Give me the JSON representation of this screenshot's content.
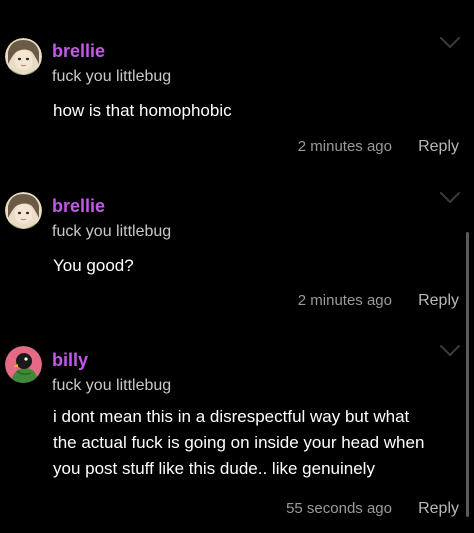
{
  "colors": {
    "background": "#000000",
    "username": "#c259e8",
    "body_text": "#ffffff",
    "secondary_text": "#c9c9c9",
    "meta_text": "#9a9a9a"
  },
  "comments": [
    {
      "username": "brellie",
      "subtitle": "fuck you littlebug",
      "body": [
        "how is that homophobic"
      ],
      "timestamp": "2 minutes ago",
      "reply_label": "Reply",
      "menu_icon": "chevron-down-icon",
      "avatar_icon": "anime-avatar-icon"
    },
    {
      "username": "brellie",
      "subtitle": "fuck you littlebug",
      "body": [
        "You good?"
      ],
      "timestamp": "2 minutes ago",
      "reply_label": "Reply",
      "menu_icon": "chevron-down-icon",
      "avatar_icon": "anime-avatar-icon"
    },
    {
      "username": "billy",
      "subtitle": "fuck you littlebug",
      "body": [
        "i dont mean this in a disrespectful way but what",
        "the actual fuck is going on inside your head when",
        "you post stuff like this dude.. like genuinely"
      ],
      "timestamp": "55 seconds ago",
      "reply_label": "Reply",
      "menu_icon": "chevron-down-icon",
      "avatar_icon": "bird-avatar-icon"
    }
  ]
}
